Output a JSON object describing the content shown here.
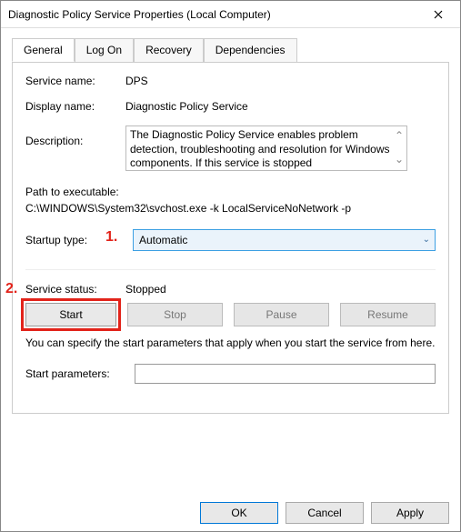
{
  "window": {
    "title": "Diagnostic Policy Service Properties (Local Computer)"
  },
  "tabs": {
    "general": "General",
    "logon": "Log On",
    "recovery": "Recovery",
    "dependencies": "Dependencies"
  },
  "labels": {
    "service_name": "Service name:",
    "display_name": "Display name:",
    "description": "Description:",
    "path_label": "Path to executable:",
    "startup_type": "Startup type:",
    "service_status": "Service status:",
    "start_params": "Start parameters:",
    "hint": "You can specify the start parameters that apply when you start the service from here."
  },
  "values": {
    "service_name": "DPS",
    "display_name": "Diagnostic Policy Service",
    "description": "The Diagnostic Policy Service enables problem detection, troubleshooting and resolution for Windows components.  If this service is stopped",
    "path": "C:\\WINDOWS\\System32\\svchost.exe -k LocalServiceNoNetwork -p",
    "startup_type": "Automatic",
    "status": "Stopped",
    "start_params": ""
  },
  "service_buttons": {
    "start": "Start",
    "stop": "Stop",
    "pause": "Pause",
    "resume": "Resume"
  },
  "dialog_buttons": {
    "ok": "OK",
    "cancel": "Cancel",
    "apply": "Apply"
  },
  "annotations": {
    "one": "1.",
    "two": "2."
  }
}
